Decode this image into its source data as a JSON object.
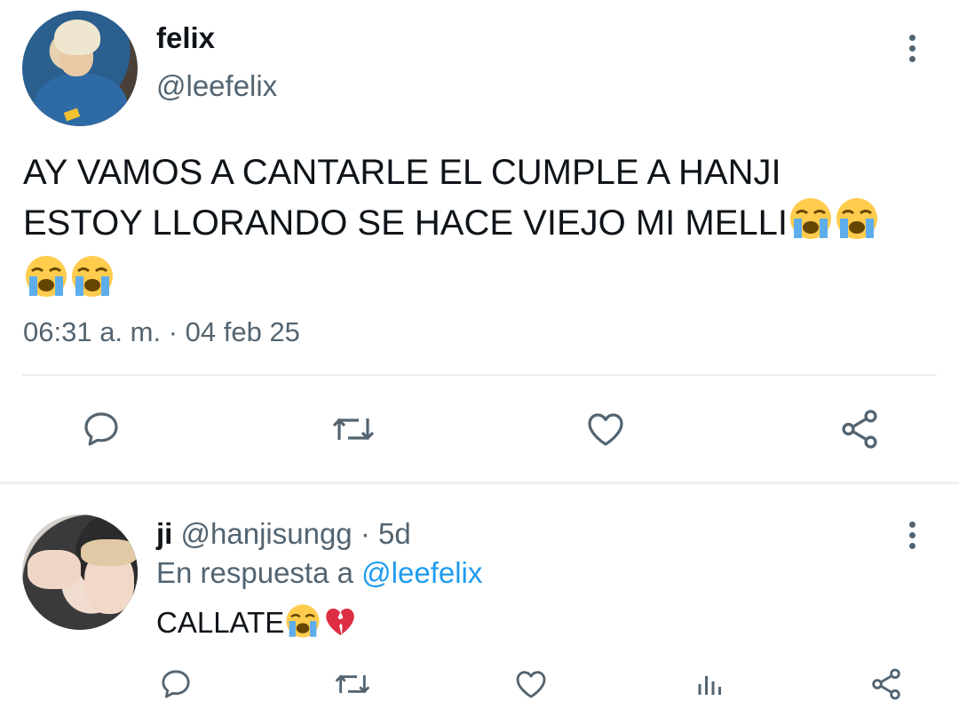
{
  "main_tweet": {
    "display_name": "felix",
    "handle": "@leefelix",
    "text_line1": "AY VAMOS A CANTARLE EL CUMPLE A HANJI",
    "text_line2": "ESTOY LLORANDO SE HACE VIEJO MI MELLI",
    "emoji_line2": [
      "crying-face",
      "crying-face"
    ],
    "emoji_line3": [
      "crying-face",
      "crying-face"
    ],
    "timestamp": "06:31 a. m. · 04 feb 25",
    "actions": [
      "reply-icon",
      "retweet-icon",
      "like-icon",
      "share-icon"
    ]
  },
  "reply_tweet": {
    "display_name": "ji",
    "handle": "@hanjisungg",
    "time": "· 5d",
    "reply_prefix": "En respuesta a",
    "reply_to": "@leefelix",
    "text": "CALLATE",
    "emojis": [
      "crying-face",
      "broken-heart"
    ],
    "actions": [
      "reply-icon",
      "retweet-icon",
      "like-icon",
      "analytics-icon",
      "share-icon"
    ]
  },
  "colors": {
    "text": "#0f1419",
    "secondary": "#536471",
    "link": "#1d9bf0",
    "divider": "#e6ecf0"
  }
}
